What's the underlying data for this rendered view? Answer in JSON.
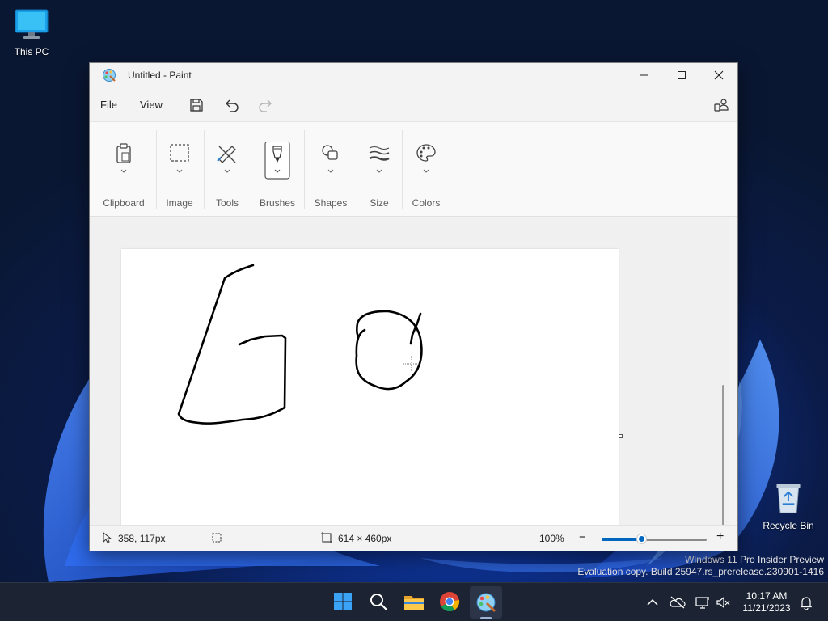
{
  "desktop": {
    "icons": [
      {
        "label": "This PC",
        "icon": "monitor-icon"
      },
      {
        "label": "Recycle Bin",
        "icon": "recycle-bin-icon"
      }
    ],
    "watermark_line1": "Windows 11 Pro Insider Preview",
    "watermark_line2": "Evaluation copy. Build 25947.rs_prerelease.230901-1416"
  },
  "window": {
    "title": "Untitled - Paint",
    "controls": {
      "minimize": "minimize-icon",
      "maximize": "maximize-icon",
      "close": "close-icon"
    }
  },
  "menu": {
    "file": "File",
    "view": "View",
    "quick_access": [
      "save-icon",
      "undo-icon",
      "redo-icon"
    ],
    "redo_enabled": false
  },
  "ribbon": {
    "groups": [
      {
        "label": "Clipboard",
        "icon": "clipboard-icon"
      },
      {
        "label": "Image",
        "icon": "selection-icon"
      },
      {
        "label": "Tools",
        "icon": "tools-icon"
      },
      {
        "label": "Brushes",
        "icon": "brush-icon",
        "selected": true
      },
      {
        "label": "Shapes",
        "icon": "shapes-icon"
      },
      {
        "label": "Size",
        "icon": "size-icon"
      },
      {
        "label": "Colors",
        "icon": "palette-icon"
      }
    ]
  },
  "status": {
    "cursor_position": "358, 117px",
    "canvas_size": "614 × 460px",
    "zoom": "100%",
    "zoom_fraction": 0.38
  },
  "taskbar": {
    "apps": [
      "windows-start-icon",
      "search-icon",
      "file-explorer-icon",
      "chrome-icon",
      "paint-icon"
    ],
    "active_app": "paint-icon",
    "time": "10:17 AM",
    "date": "11/21/2023"
  },
  "colors": {
    "accent": "#0067c0",
    "stroke": "#000000"
  }
}
